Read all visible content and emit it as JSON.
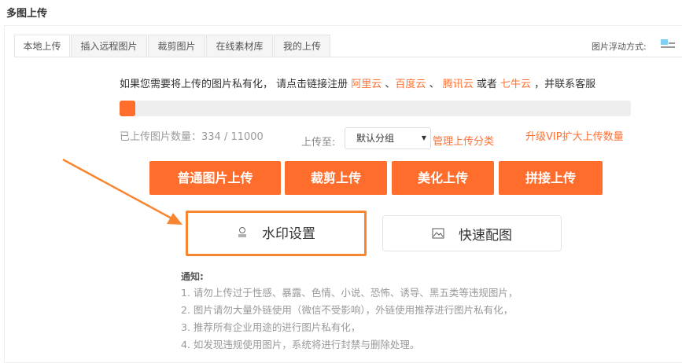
{
  "title": "多图上传",
  "tabs": [
    {
      "label": "本地上传"
    },
    {
      "label": "插入远程图片"
    },
    {
      "label": "裁剪图片"
    },
    {
      "label": "在线素材库"
    },
    {
      "label": "我的上传"
    }
  ],
  "float_label": "图片浮动方式:",
  "notice": {
    "prefix": "如果您需要将上传的图片私有化， 请点击链接注册 ",
    "aliyun": "阿里云",
    "sep1": " 、",
    "baidu": "百度云",
    "sep2": " 、 ",
    "tencent": "腾讯云",
    "or": " 或者 ",
    "qiniu": "七牛云",
    "suffix": " ，并联系客服"
  },
  "progress": {
    "uploaded": 334,
    "limit": 11000,
    "fraction": 0.0304
  },
  "count_text": "已上传图片数量：334 / 11000",
  "upload_to_label": "上传至:",
  "group_select": "默认分组",
  "manage_link": "管理上传分类",
  "vip_link": "升级VIP扩大上传数量",
  "buttons": {
    "normal": "普通图片上传",
    "crop": "裁剪上传",
    "beautify": "美化上传",
    "splice": "拼接上传",
    "watermark": "水印设置",
    "quick": "快速配图"
  },
  "notes": {
    "heading": "通知:",
    "items": [
      "1. 请勿上传过于性感、暴露、色情、小说、恐怖、诱导、黑五类等违规图片，",
      "2. 图片请勿大量外链使用（微信不受影响），外链使用推荐进行图片私有化，",
      "3. 推荐所有企业用途的进行图片私有化，",
      "4. 如发现违规使用图片，系统将进行封禁与删除处理。"
    ]
  },
  "colors": {
    "accent": "#ff6d2c",
    "highlight": "#f88630"
  }
}
